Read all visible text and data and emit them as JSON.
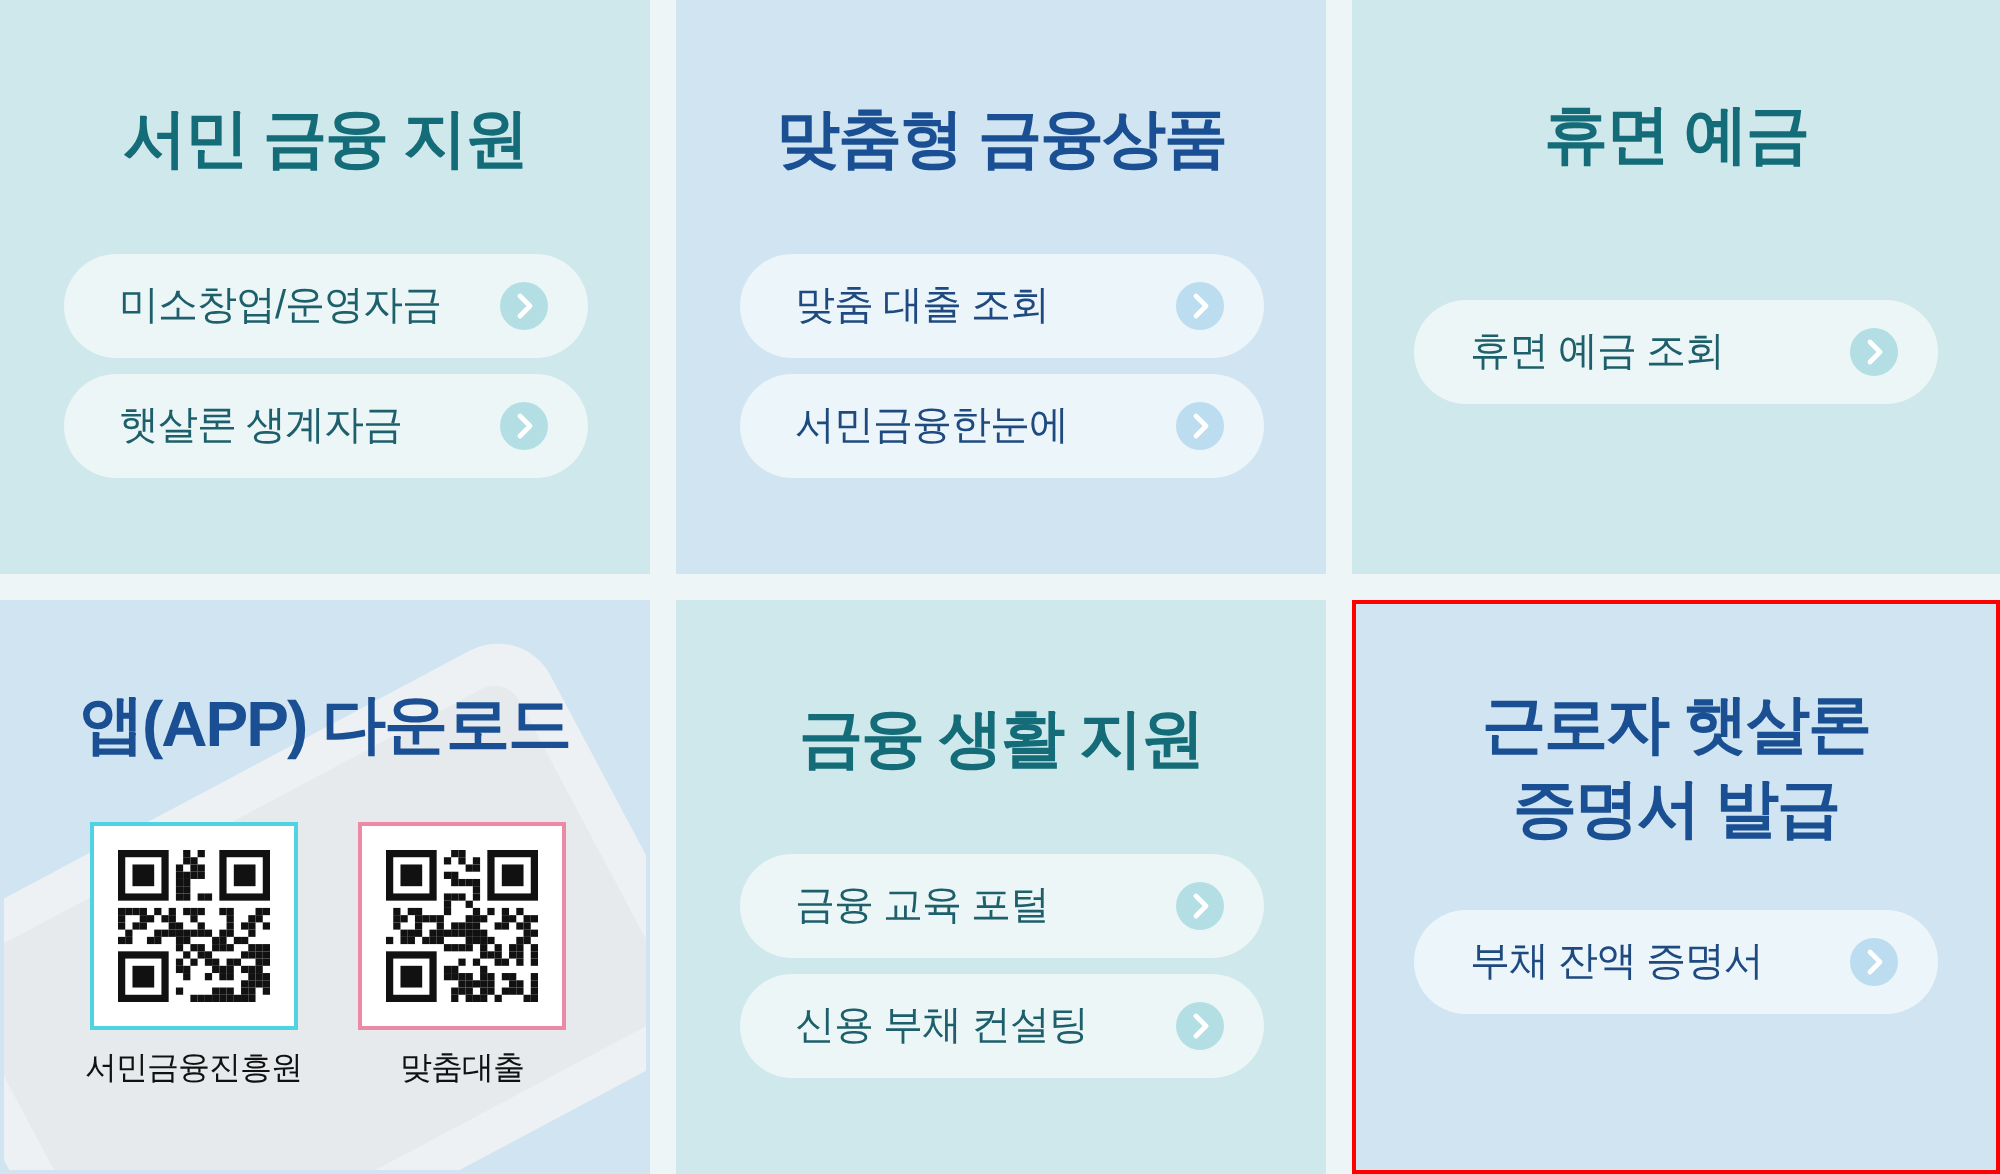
{
  "cards": [
    {
      "kind": "links",
      "color": "#cfe8ec",
      "highlighted": false,
      "title": [
        "서민 금융 지원"
      ],
      "links": [
        "미소창업/운영자금",
        "햇살론 생계자금"
      ]
    },
    {
      "kind": "links",
      "color": "#d0e5f1",
      "highlighted": false,
      "title": [
        "맞춤형 금융상품"
      ],
      "links": [
        "맞춤 대출 조회",
        "서민금융한눈에"
      ]
    },
    {
      "kind": "links",
      "color": "#cfe8ec",
      "highlighted": false,
      "title": [
        "휴면 예금"
      ],
      "links": [
        "휴면 예금 조회"
      ]
    },
    {
      "kind": "qr",
      "color": "#d0e5f1",
      "highlighted": false,
      "title": [
        "앱(APP) 다운로드"
      ],
      "qr_codes": [
        {
          "label": "서민금융진흥원",
          "color": "#4fd3e3"
        },
        {
          "label": "맞춤대출",
          "color": "#ec8aa6"
        }
      ]
    },
    {
      "kind": "links",
      "color": "#cfe8ec",
      "highlighted": false,
      "title": [
        "금융 생활 지원"
      ],
      "links": [
        "금융 교육 포털",
        "신용 부채 컨설팅"
      ]
    },
    {
      "kind": "links",
      "color": "#d0e5f1",
      "highlighted": true,
      "title": [
        "근로자 햇살론",
        "증명서 발급"
      ],
      "links": [
        "부채 잔액 증명서"
      ]
    }
  ]
}
